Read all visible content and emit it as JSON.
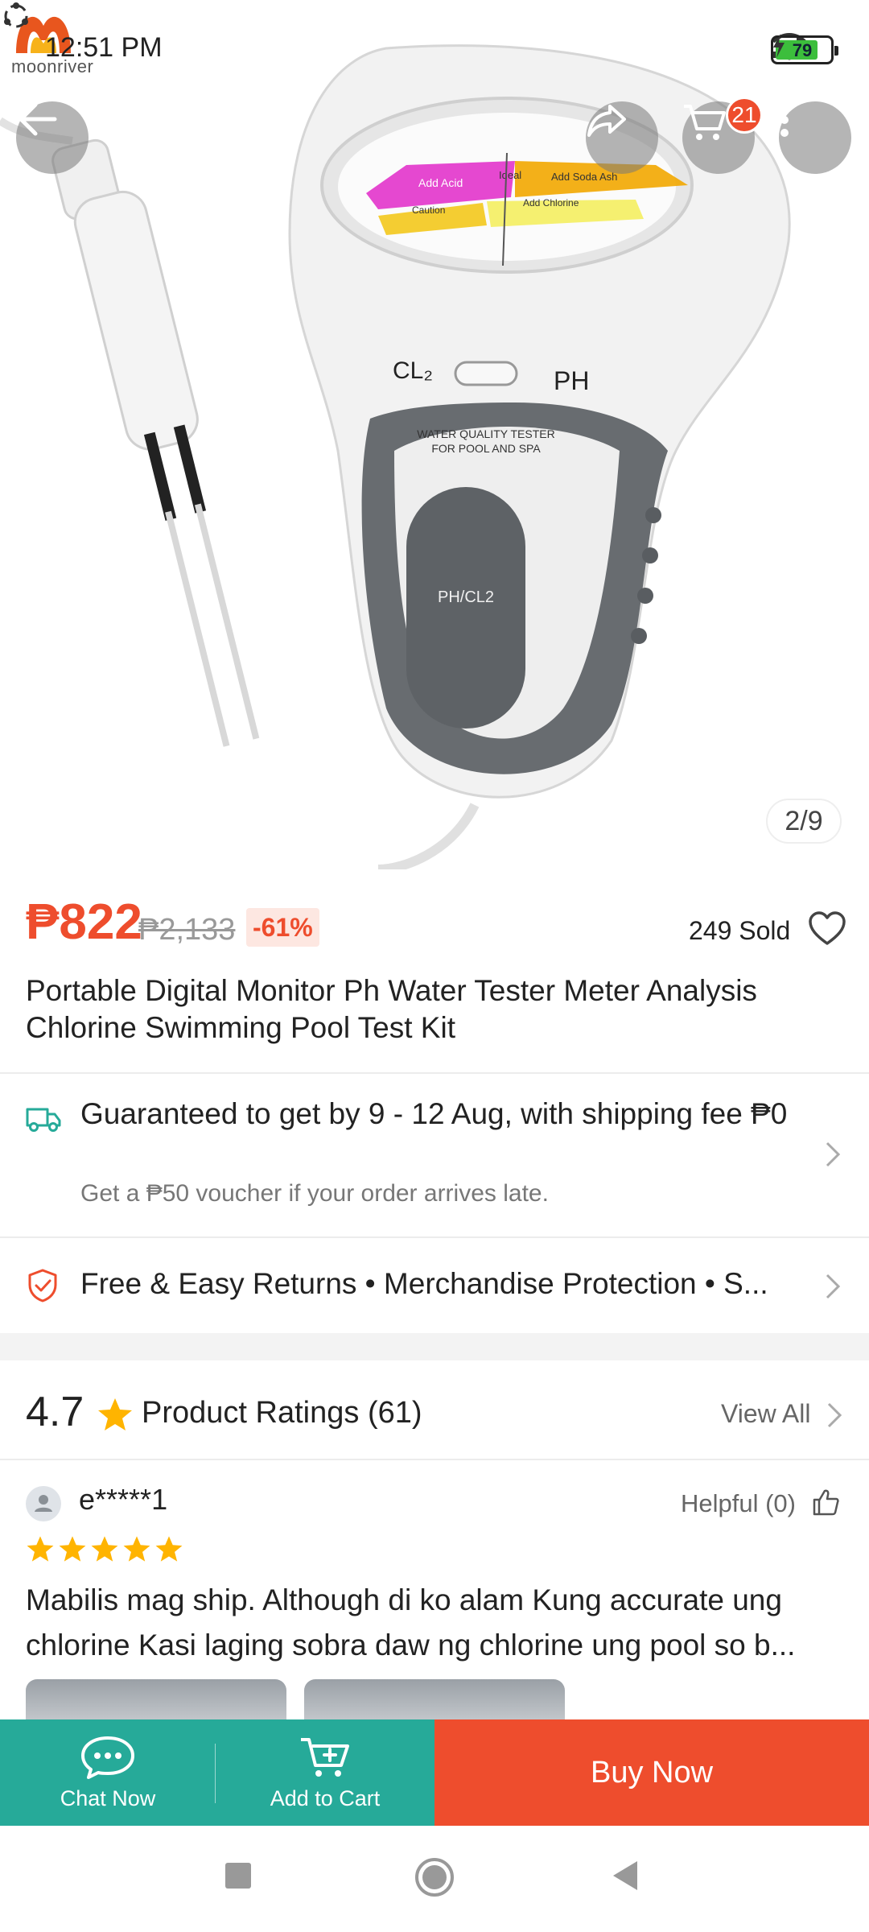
{
  "status_bar": {
    "logo_text": "moonriver",
    "time": "12:51 PM",
    "battery_level": "79",
    "battery_fraction": 0.79
  },
  "header": {
    "cart_badge": "21",
    "image_counter": "2/9",
    "icons": [
      "back-arrow-icon",
      "share-icon",
      "cart-icon",
      "more-vertical-icon"
    ]
  },
  "product_image_text": {
    "cl2": "CL₂",
    "ph": "PH",
    "tester_line1": "WATER QUALITY TESTER",
    "tester_line2": "FOR POOL AND SPA",
    "button_label": "PH/CL2",
    "dial_add_acid": "Add Acid",
    "dial_ideal": "Ideal",
    "dial_add_soda": "Add Soda Ash",
    "dial_caution": "Caution",
    "dial_add_chlorine": "Add Chlorine"
  },
  "product": {
    "price": "₱822",
    "original_price": "₱2,133",
    "discount": "-61%",
    "sold": "249 Sold",
    "title": "Portable Digital Monitor Ph Water Tester Meter Analysis Chlorine Swimming Pool Test Kit"
  },
  "shipping": {
    "title": "Guaranteed to get by 9 - 12 Aug, with shipping fee ₱0",
    "voucher": "Get a ₱50 voucher if your order arrives late."
  },
  "returns": {
    "text": "Free & Easy Returns  •  Merchandise Protection  •  S..."
  },
  "ratings": {
    "score": "4.7",
    "label": "Product Ratings",
    "count": "(61)",
    "view_all": "View All"
  },
  "review": {
    "reviewer": "e*****1",
    "helpful": "Helpful (0)",
    "stars": 5,
    "text": "Mabilis mag ship. Although di ko alam Kung accurate ung chlorine Kasi laging sobra daw ng chlorine ung pool so b..."
  },
  "actions": {
    "chat": "Chat Now",
    "add_to_cart": "Add to Cart",
    "buy_now": "Buy Now"
  },
  "colors": {
    "accent": "#ee4d2d",
    "teal": "#26aa99",
    "star": "#ffb400"
  }
}
